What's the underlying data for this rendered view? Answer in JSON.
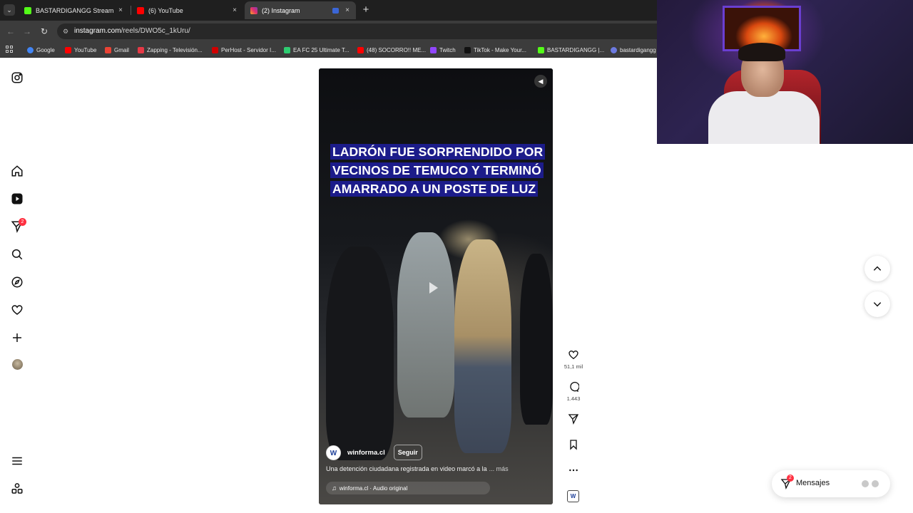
{
  "browser": {
    "tabs": [
      {
        "title": "BASTARDIGANGG Stream - Wa",
        "favicon_color": "#53fc18",
        "active": false
      },
      {
        "title": "(6) YouTube",
        "favicon_color": "#ff0000",
        "active": false
      },
      {
        "title": "(2) Instagram",
        "favicon_color": "#e1306c",
        "active": true
      }
    ],
    "close_glyph": "×",
    "new_tab_glyph": "+",
    "url_host": "instagram.com",
    "url_path": "/reels/DWO5c_1kUru/",
    "bookmarks": [
      {
        "label": "Google",
        "color": "#4285f4"
      },
      {
        "label": "YouTube",
        "color": "#ff0000"
      },
      {
        "label": "Gmail",
        "color": "#ea4335"
      },
      {
        "label": "Zapping - Televisión...",
        "color": "#e63946"
      },
      {
        "label": "PerHost - Servidor I...",
        "color": "#d00000"
      },
      {
        "label": "EA FC 25 Ultimate T...",
        "color": "#2ecc71"
      },
      {
        "label": "(48) SOCORRO!! ME...",
        "color": "#ff0000"
      },
      {
        "label": "Twitch",
        "color": "#9146ff"
      },
      {
        "label": "TikTok - Make Your...",
        "color": "#111111"
      },
      {
        "label": "BASTARDIGANGG |...",
        "color": "#53fc18"
      },
      {
        "label": "bastardigangg",
        "color": "#6c7ae0"
      }
    ]
  },
  "sidebar": {
    "notifications_badge": "2",
    "icons": [
      "instagram-logo-icon",
      "home-icon",
      "reels-icon",
      "messages-icon",
      "search-icon",
      "explore-icon",
      "heart-icon",
      "create-icon",
      "profile-avatar",
      "menu-icon",
      "more-apps-icon"
    ]
  },
  "reel": {
    "headline": "LADRÓN FUE SORPRENDIDO POR VECINOS DE TEMUCO Y TERMINÓ AMARRADO A UN POSTE DE LUZ",
    "author": "winforma.cl",
    "author_avatar_letter": "W",
    "follow_label": "Seguir",
    "caption": "Una detención ciudadana registrada en video marcó a la",
    "caption_more": "... más",
    "audio": "winforma.cl · Audio original",
    "audio_note": "♫"
  },
  "actions": {
    "likes": "51,1 mil",
    "comments": "1.443"
  },
  "messages_widget": {
    "label": "Mensajes",
    "badge": "2"
  },
  "colors": {
    "headline_bg": "#1c1c8a",
    "badge_red": "#ff3040",
    "browser_dark": "#1f1f1f"
  }
}
